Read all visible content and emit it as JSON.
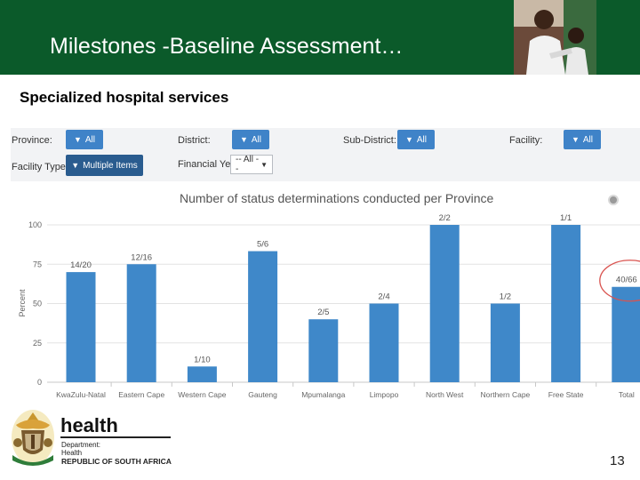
{
  "slide": {
    "title": "Milestones -Baseline Assessment…",
    "subtitle": "Specialized hospital services",
    "page_number": "13"
  },
  "filters": {
    "province": {
      "label": "Province:",
      "value": "All"
    },
    "district": {
      "label": "District:",
      "value": "All"
    },
    "sub_district": {
      "label": "Sub-District:",
      "value": "All"
    },
    "facility": {
      "label": "Facility:",
      "value": "All"
    },
    "facility_type": {
      "label": "Facility Type:",
      "value": "Multiple Items"
    },
    "financial_year": {
      "label": "Financial Year:",
      "value": "-- All --"
    }
  },
  "logo": {
    "word": "health",
    "line1": "Department:",
    "line2": "Health",
    "line3": "REPUBLIC OF SOUTH AFRICA"
  },
  "colors": {
    "header": "#0b5a2a",
    "bar": "#3f88c9",
    "highlight_circle": "#d9534f"
  },
  "chart_data": {
    "type": "bar",
    "title": "Number of status determinations conducted per Province",
    "ylabel": "Percent",
    "xlabel": "",
    "ylim": [
      0,
      100
    ],
    "yticks": [
      0,
      25,
      50,
      75,
      100
    ],
    "grid": true,
    "categories": [
      "KwaZulu-Natal",
      "Eastern Cape",
      "Western Cape",
      "Gauteng",
      "Mpumalanga",
      "Limpopo",
      "North West",
      "Northern Cape",
      "Free State",
      "Total"
    ],
    "values": [
      70,
      75,
      10,
      83.3,
      40,
      50,
      100,
      50,
      100,
      60.6
    ],
    "data_labels": [
      "14/20",
      "12/16",
      "1/10",
      "5/6",
      "2/5",
      "2/4",
      "2/2",
      "1/2",
      "1/1",
      "40/66"
    ],
    "highlighted_category": "Total"
  }
}
